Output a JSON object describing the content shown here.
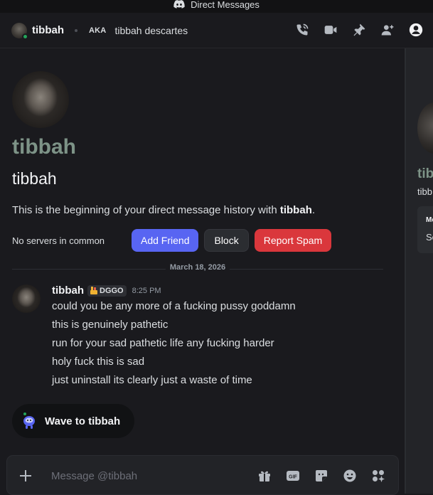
{
  "window": {
    "title": "Direct Messages"
  },
  "header": {
    "username": "tibbah",
    "aka_label": "AKA",
    "aka_name": "tibbah descartes"
  },
  "intro": {
    "display_name": "tibbah",
    "username": "tibbah",
    "description_prefix": "This is the beginning of your direct message history with ",
    "description_user": "tibbah",
    "description_suffix": ".",
    "no_servers": "No servers in common",
    "add_friend": "Add Friend",
    "block": "Block",
    "report_spam": "Report Spam"
  },
  "divider": {
    "date": "March 18, 2026"
  },
  "message": {
    "author": "tibbah",
    "tag": "DGGO",
    "time": "8:25 PM",
    "lines": [
      "could you be any more of a fucking pussy goddamn",
      "this is genuinely pathetic",
      "run for your sad pathetic life any fucking harder",
      "holy fuck this is sad",
      "just uninstall its clearly just a waste of time"
    ]
  },
  "wave": {
    "label": "Wave to tibbah"
  },
  "composer": {
    "placeholder": "Message @tibbah"
  },
  "right_panel": {
    "name": "tib",
    "sub": "tibb",
    "box_title": "Me",
    "box_text": "Se"
  },
  "colors": {
    "accent": "#5865f2",
    "danger": "#da373c",
    "online": "#23a55a",
    "display_name": "#7d9387"
  }
}
